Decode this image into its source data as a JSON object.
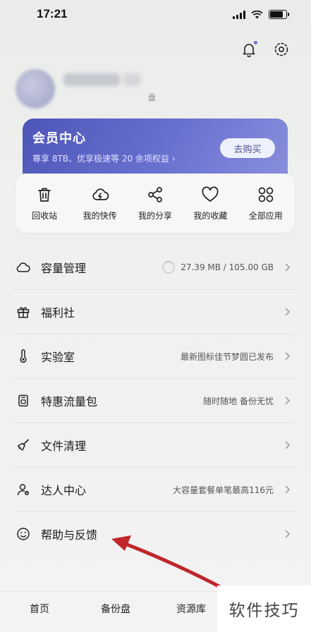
{
  "status_bar": {
    "time": "17:21"
  },
  "profile": {
    "pan_tag": "盘"
  },
  "vip_card": {
    "title": "会员中心",
    "subtitle": "尊享 8TB、优享极速等 20 余项权益 ›",
    "button": "去购买"
  },
  "quick_actions": [
    {
      "label": "回收站",
      "icon": "trash-icon"
    },
    {
      "label": "我的快传",
      "icon": "cloud-bolt-icon"
    },
    {
      "label": "我的分享",
      "icon": "share-icon"
    },
    {
      "label": "我的收藏",
      "icon": "heart-icon"
    },
    {
      "label": "全部应用",
      "icon": "apps-grid-icon"
    }
  ],
  "menu": [
    {
      "label": "容量管理",
      "right": "27.39 MB / 105.00 GB",
      "icon": "cloud-icon"
    },
    {
      "label": "福利社",
      "right": "",
      "icon": "gift-icon"
    },
    {
      "label": "实验室",
      "right": "最新图标佳节梦圆已发布",
      "icon": "thermometer-icon"
    },
    {
      "label": "特惠流量包",
      "right": "随时随地 备份无忧",
      "icon": "sim-card-icon"
    },
    {
      "label": "文件清理",
      "right": "",
      "icon": "broom-icon"
    },
    {
      "label": "达人中心",
      "right": "大容量套餐单笔最高116元",
      "icon": "user-check-icon"
    },
    {
      "label": "帮助与反馈",
      "right": "",
      "icon": "smile-icon"
    }
  ],
  "bottom_nav": {
    "tabs": [
      "首页",
      "备份盘",
      "资源库"
    ]
  },
  "watermark": {
    "text": "软件技巧"
  },
  "colors": {
    "vip_start": "#4d55b8",
    "vip_end": "#8a8fdc",
    "arrow": "#c0262c",
    "accent_dot": "#6b6fd6"
  }
}
